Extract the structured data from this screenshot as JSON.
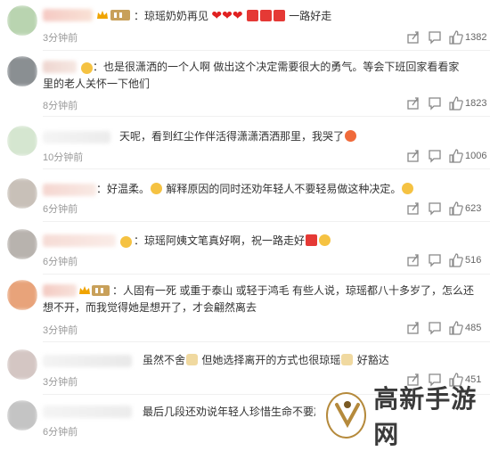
{
  "comments": [
    {
      "text_parts": [
        "琼瑶奶奶再见",
        "一路好走"
      ],
      "time": "3分钟前",
      "likes": "1382"
    },
    {
      "text": "也是很潇洒的一个人啊 做出这个决定需要很大的勇气。等会下班回家看看家里的老人关怀一下他们",
      "time": "8分钟前",
      "likes": "1823"
    },
    {
      "text": "天呢，看到红尘作伴活得潇潇洒洒那里，我哭了",
      "time": "10分钟前",
      "likes": "1006"
    },
    {
      "text_a": "好温柔。",
      "text_b": "解释原因的同时还劝年轻人不要轻易做这种决定。",
      "time": "6分钟前",
      "likes": "623"
    },
    {
      "text": "琼瑶阿姨文笔真好啊，祝一路走好",
      "time": "6分钟前",
      "likes": "516"
    },
    {
      "text": "人固有一死 或重于泰山 或轻于鸿毛 有些人说，琼瑶都八十多岁了，怎么还想不开，而我觉得她是想开了，才会翩然离去",
      "time": "3分钟前",
      "likes": "485"
    },
    {
      "text_a": "虽然不舍",
      "text_b": "但她选择离开的方式也很琼瑶",
      "text_c": "好豁达",
      "time": "3分钟前",
      "likes": "451"
    },
    {
      "text": "最后几段还劝说年轻人珍惜生命不要放弃",
      "time": "6分钟前"
    }
  ],
  "watermark": {
    "text": "高新手游网"
  },
  "colors": {
    "heart": "#e02020",
    "gift": "#e53935",
    "face": "#f5c242",
    "time": "#999999"
  }
}
